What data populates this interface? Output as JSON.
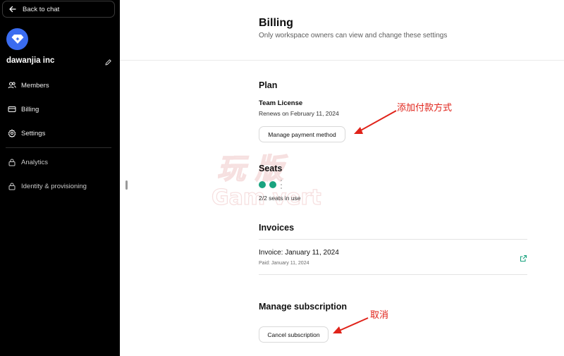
{
  "sidebar": {
    "back_label": "Back to chat",
    "workspace_name": "dawanjia inc",
    "items": [
      {
        "label": "Members",
        "icon": "members-icon"
      },
      {
        "label": "Billing",
        "icon": "card-icon"
      },
      {
        "label": "Settings",
        "icon": "gear-icon"
      },
      {
        "label": "Analytics",
        "icon": "lock-icon"
      },
      {
        "label": "Identity & provisioning",
        "icon": "lock-icon"
      }
    ]
  },
  "header": {
    "title": "Billing",
    "subtitle": "Only workspace owners can view and change these settings"
  },
  "plan": {
    "heading": "Plan",
    "name": "Team License",
    "renews": "Renews on February 11, 2024",
    "manage_button": "Manage payment method"
  },
  "seats": {
    "heading": "Seats",
    "used": 2,
    "total": 2,
    "usage_text": "2/2 seats in use"
  },
  "invoices": {
    "heading": "Invoices",
    "items": [
      {
        "title": "Invoice: January 11, 2024",
        "paid": "Paid: January 11, 2024"
      }
    ]
  },
  "subscription": {
    "heading": "Manage subscription",
    "cancel_button": "Cancel subscription"
  },
  "annotations": {
    "add_payment": "添加付款方式",
    "cancel": "取消"
  },
  "watermark": {
    "cn": "玩 版",
    "en": "Gam vert"
  },
  "colors": {
    "sidebar_bg": "#000000",
    "accent_logo": "#3a6cf0",
    "seat_green": "#19a37f",
    "annotation_red": "#e0231a"
  }
}
